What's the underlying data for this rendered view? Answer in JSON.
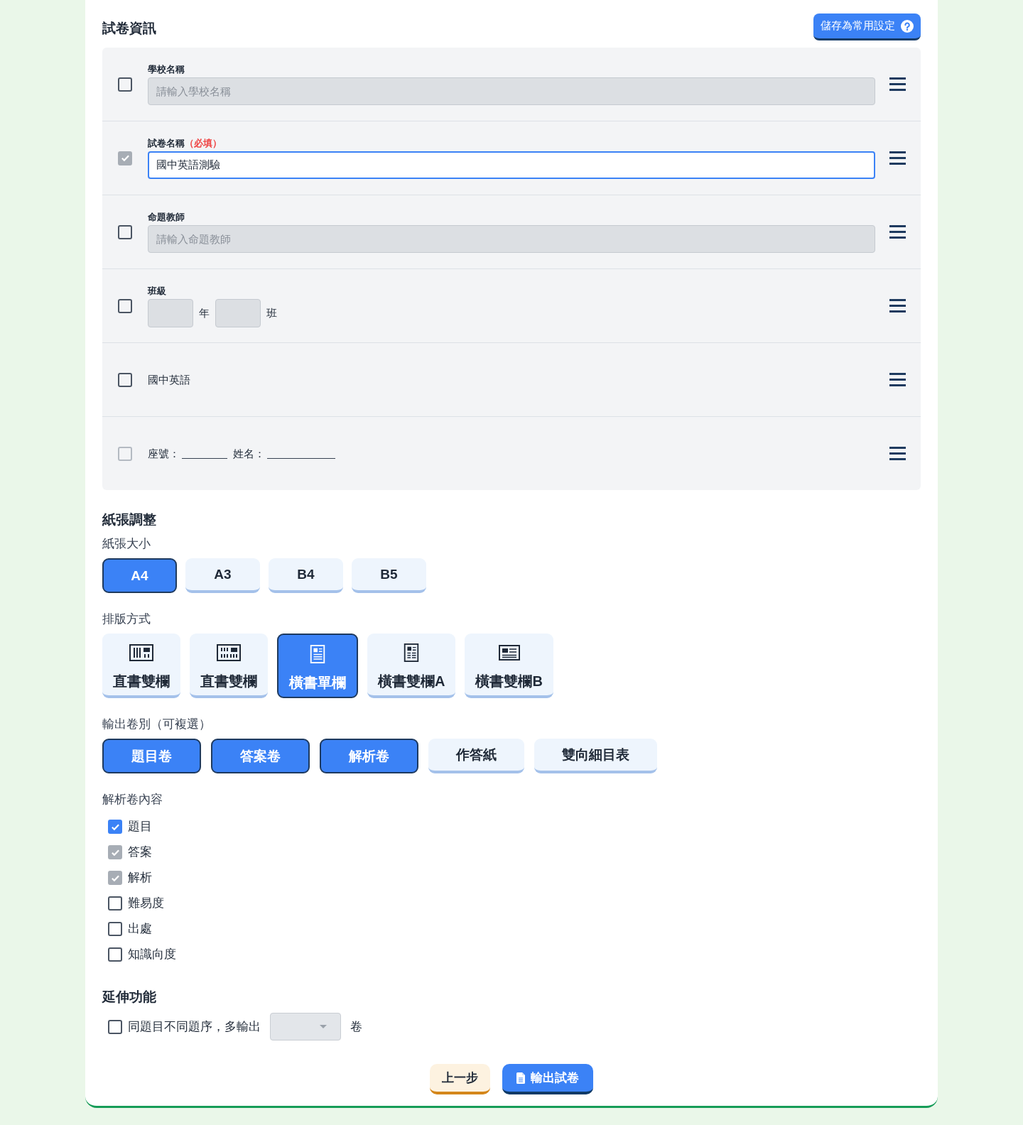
{
  "paper_info": {
    "title": "試卷資訊",
    "save_button": {
      "label": "儲存為常用設定"
    },
    "rows": [
      {
        "kind": "text-input",
        "label": "學校名稱",
        "placeholder": "請輸入學校名稱",
        "checked": false,
        "disabled": false,
        "focused": false
      },
      {
        "kind": "text-input",
        "label": "試卷名稱",
        "required_note": "（必填）",
        "value": "國中英語測驗",
        "checked": true,
        "disabled": true,
        "focused": true
      },
      {
        "kind": "text-input",
        "label": "命題教師",
        "placeholder": "請輸入命題教師",
        "checked": false,
        "disabled": false,
        "focused": false
      },
      {
        "kind": "class",
        "label": "班級",
        "units": [
          "年",
          "班"
        ],
        "checked": false,
        "disabled": false
      },
      {
        "kind": "text",
        "text": "國中英語",
        "checked": false,
        "disabled": false
      },
      {
        "kind": "blanks",
        "blanks": [
          {
            "label": "座號："
          },
          {
            "label": "姓名："
          }
        ],
        "checked": false,
        "disabled": true
      }
    ]
  },
  "paper_adjustment": {
    "title": "紙張調整",
    "paper_size": {
      "label": "紙張大小",
      "options": [
        {
          "label": "A4",
          "selected": true
        },
        {
          "label": "A3",
          "selected": false
        },
        {
          "label": "B4",
          "selected": false
        },
        {
          "label": "B5",
          "selected": false
        }
      ]
    },
    "layout": {
      "label": "排版方式",
      "options": [
        {
          "kind": "vertical",
          "label": "直書雙欄",
          "selected": false
        },
        {
          "kind": "verticalgrid",
          "label": "直書雙欄",
          "selected": false
        },
        {
          "kind": "single",
          "label": "橫書單欄",
          "selected": true
        },
        {
          "kind": "double",
          "label": "橫書雙欄A",
          "selected": false
        },
        {
          "kind": "wide",
          "label": "橫書雙欄B",
          "selected": false
        }
      ]
    },
    "output_types": {
      "label": "輸出卷別（可複選）",
      "options": [
        {
          "label": "題目卷",
          "selected": true
        },
        {
          "label": "答案卷",
          "selected": true
        },
        {
          "label": "解析卷",
          "selected": true
        },
        {
          "label": "作答紙",
          "selected": false
        },
        {
          "label": "雙向細目表",
          "selected": false
        }
      ]
    },
    "analysis_content": {
      "label": "解析卷內容",
      "options": [
        {
          "label": "題目",
          "checked": true,
          "disabled": false
        },
        {
          "label": "答案",
          "checked": true,
          "disabled": true
        },
        {
          "label": "解析",
          "checked": true,
          "disabled": true
        },
        {
          "label": "難易度",
          "checked": false,
          "disabled": false
        },
        {
          "label": "出處",
          "checked": false,
          "disabled": false
        },
        {
          "label": "知識向度",
          "checked": false,
          "disabled": false
        }
      ]
    }
  },
  "extension": {
    "title": "延伸功能",
    "option": {
      "label": "同題目不同題序，多輸出",
      "checked": false,
      "disabled": false
    },
    "copies_select": {
      "disabled": true
    },
    "unit": "卷"
  },
  "footer_buttons": [
    {
      "kind": "secondary",
      "label": "上一步"
    },
    {
      "kind": "primary",
      "label": "輸出試卷"
    }
  ]
}
